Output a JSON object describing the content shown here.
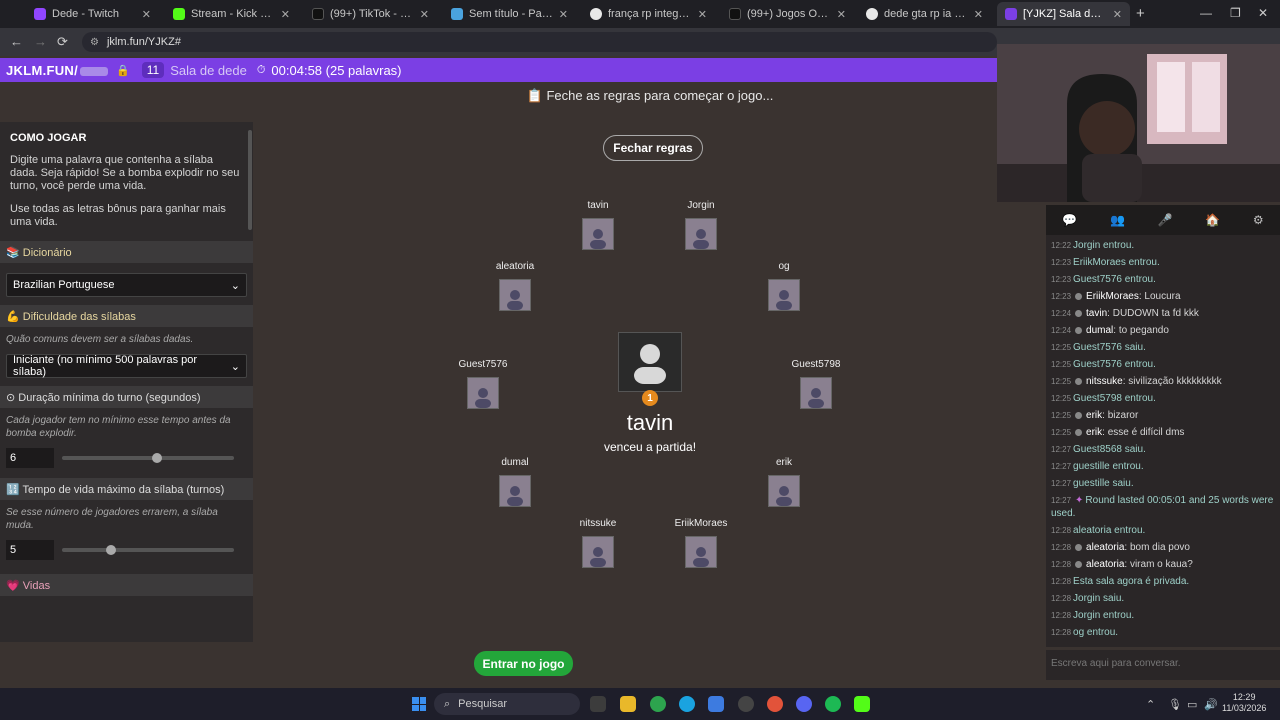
{
  "browser": {
    "tabs": [
      {
        "label": "Dede - Twitch",
        "color": "#9146ff"
      },
      {
        "label": "Stream - Kick Dashboard",
        "color": "#53fc18"
      },
      {
        "label": "(99+) TikTok - Make Your",
        "color": "#111111"
      },
      {
        "label": "Sem título - Paint",
        "color": "#4aa3df"
      },
      {
        "label": "frança rp integrantes - Pe",
        "color": "#e8e8e8"
      },
      {
        "label": "(99+) Jogos Online Diverti",
        "color": "#111111"
      },
      {
        "label": "dede gta rp ia - Pesquisa",
        "color": "#e8e8e8"
      },
      {
        "label": "[YJKZ] Sala de dede",
        "color": "#7b3fe4"
      }
    ],
    "url": "jklm.fun/YJKZ#"
  },
  "header": {
    "brand": "JKLM.FUN/",
    "player_count": "11",
    "room_name": "Sala de dede",
    "timer": "00:04:58 (25 palavras)"
  },
  "status": "📋 Feche as regras para começar o jogo...",
  "rules": {
    "title": "COMO JOGAR",
    "intro1": "Digite uma palavra que contenha a sílaba dada. Seja rápido! Se a bomba explodir no seu turno, você perde uma vida.",
    "intro2": "Use todas as letras bônus para ganhar mais uma vida.",
    "dictionary_label": "📚 Dicionário",
    "dictionary_value": "Brazilian Portuguese",
    "difficulty_label": "💪 Dificuldade das sílabas",
    "difficulty_hint": "Quão comuns devem ser a sílabas dadas.",
    "difficulty_value": "Iniciante (no mínimo 500 palavras por sílaba)",
    "duration_label": "⊙ Duração mínima do turno (segundos)",
    "duration_hint": "Cada jogador tem no mínimo esse tempo antes da bomba explodir.",
    "duration_value": "6",
    "lifetime_label": "🔢 Tempo de vida máximo da sílaba (turnos)",
    "lifetime_hint": "Se esse número de jogadores errarem, a sílaba muda.",
    "lifetime_value": "5",
    "lives_label": "💗 Vidas"
  },
  "game": {
    "close_rules": "Fechar regras",
    "players": [
      "tavin",
      "Jorgin",
      "aleatoria",
      "og",
      "Guest7576",
      "Guest5798",
      "dumal",
      "erik",
      "nitssuke",
      "EriikMoraes"
    ],
    "winner": "tavin",
    "winner_badge": "1",
    "winner_msg": "venceu a partida!",
    "join_button": "Entrar no jogo"
  },
  "chat": {
    "tabs": [
      "💬",
      "👥",
      "🎤",
      "🏠",
      "⚙"
    ],
    "messages": [
      {
        "time": "12:22",
        "text": "Jorgin entrou.",
        "sys": true
      },
      {
        "time": "12:23",
        "text": "EriikMoraes entrou.",
        "sys": true
      },
      {
        "time": "12:23",
        "text": "Guest7576 entrou.",
        "sys": true
      },
      {
        "time": "12:23",
        "name": "EriikMoraes",
        "text": "Loucura"
      },
      {
        "time": "12:24",
        "name": "tavin",
        "text": "DUDOWN ta fd kkk"
      },
      {
        "time": "12:24",
        "name": "dumal",
        "text": "to pegando"
      },
      {
        "time": "12:25",
        "text": "Guest7576 saiu.",
        "sys": true
      },
      {
        "time": "12:25",
        "text": "Guest7576 entrou.",
        "sys": true
      },
      {
        "time": "12:25",
        "name": "nitssuke",
        "text": "sivilização kkkkkkkkk"
      },
      {
        "time": "12:25",
        "text": "Guest5798 entrou.",
        "sys": true
      },
      {
        "time": "12:25",
        "name": "erik",
        "text": "bizaror"
      },
      {
        "time": "12:25",
        "name": "erik",
        "text": "esse é difícil dms"
      },
      {
        "time": "12:27",
        "text": "Guest8568 saiu.",
        "sys": true
      },
      {
        "time": "12:27",
        "text": "guestille entrou.",
        "sys": true
      },
      {
        "time": "12:27",
        "text": "guestille saiu.",
        "sys": true
      },
      {
        "time": "12:27",
        "text": "Round lasted 00:05:01 and 25 words were used.",
        "sys": true,
        "round": true
      },
      {
        "time": "12:28",
        "text": "aleatoria entrou.",
        "sys": true
      },
      {
        "time": "12:28",
        "name": "aleatoria",
        "text": "bom dia povo"
      },
      {
        "time": "12:28",
        "name": "aleatoria",
        "text": "viram o kaua?"
      },
      {
        "time": "12:28",
        "text": "Esta sala agora é privada.",
        "sys": true
      },
      {
        "time": "12:28",
        "text": "Jorgin saiu.",
        "sys": true
      },
      {
        "time": "12:28",
        "text": "Jorgin entrou.",
        "sys": true
      },
      {
        "time": "12:28",
        "text": "og entrou.",
        "sys": true
      }
    ],
    "input_placeholder": "Escreva aqui para conversar."
  },
  "taskbar": {
    "search": "Pesquisar",
    "time": "12:29",
    "date": "11/03/2026"
  }
}
